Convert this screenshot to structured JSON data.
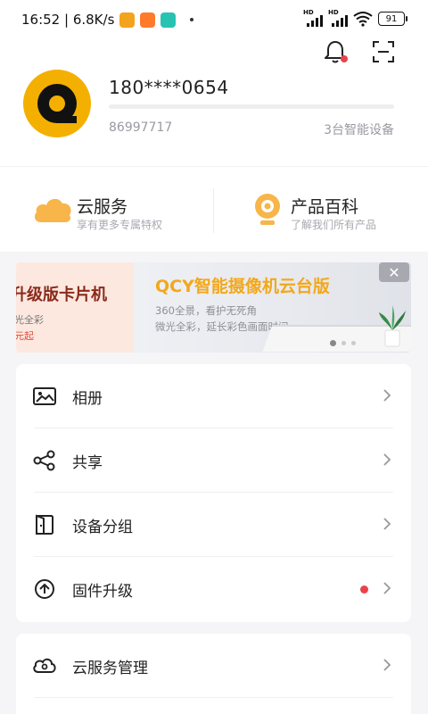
{
  "status_bar": {
    "time_speed": "16:52 | 6.8K/s",
    "battery": "91",
    "signal_label": "HD"
  },
  "profile": {
    "phone": "180****0654",
    "user_id": "86997717",
    "device_count": "3台智能设备"
  },
  "services": [
    {
      "title": "云服务",
      "subtitle": "享有更多专属特权"
    },
    {
      "title": "产品百科",
      "subtitle": "了解我们所有产品"
    }
  ],
  "banner": {
    "prev_title": "升级版卡片机",
    "prev_line1": "光全彩",
    "prev_line2": "元起",
    "title": "QCY智能摄像机云台版",
    "line1": "360全景，看护无死角",
    "line2": "微光全彩，延长彩色画面时间",
    "close": "✕"
  },
  "menu_main": [
    {
      "label": "相册",
      "icon": "photo-album-icon"
    },
    {
      "label": "共享",
      "icon": "share-icon"
    },
    {
      "label": "设备分组",
      "icon": "device-group-icon"
    },
    {
      "label": "固件升级",
      "icon": "firmware-upgrade-icon",
      "badge": true
    }
  ],
  "menu_secondary": [
    {
      "label": "云服务管理",
      "icon": "cloud-manage-icon"
    }
  ],
  "colors": {
    "accent_yellow": "#f4b000",
    "banner_title": "#f2a81c",
    "badge_red": "#e9434a"
  }
}
